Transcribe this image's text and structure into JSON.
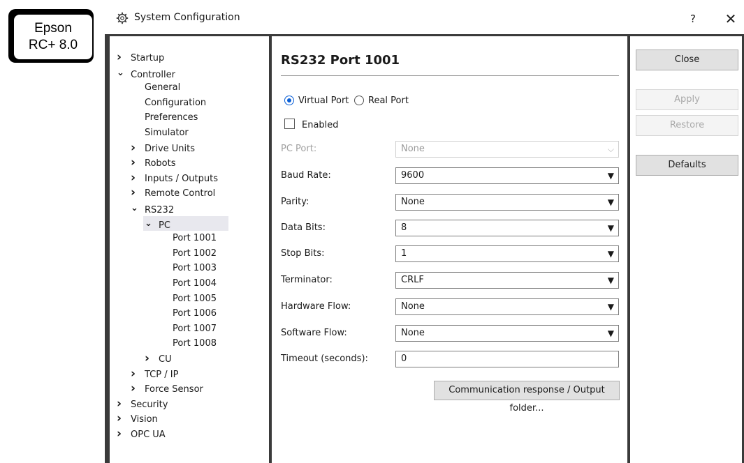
{
  "badge": {
    "line1": "Epson",
    "line2": "RC+ 8.0"
  },
  "window": {
    "title": "System Configuration",
    "help": "?",
    "close": "✕"
  },
  "tree": [
    {
      "label": "Startup",
      "chev": "›",
      "indent": 0
    },
    {
      "label": "Controller",
      "chev": "⌄",
      "indent": 0
    },
    {
      "label": "General",
      "chev": "",
      "indent": 1
    },
    {
      "label": "Configuration",
      "chev": "",
      "indent": 1
    },
    {
      "label": "Preferences",
      "chev": "",
      "indent": 1
    },
    {
      "label": "Simulator",
      "chev": "",
      "indent": 1
    },
    {
      "label": "Drive Units",
      "chev": "›",
      "indent": 1
    },
    {
      "label": "Robots",
      "chev": "›",
      "indent": 1
    },
    {
      "label": "Inputs / Outputs",
      "chev": "›",
      "indent": 1
    },
    {
      "label": "Remote Control",
      "chev": "›",
      "indent": 1
    },
    {
      "label": "RS232",
      "chev": "⌄",
      "indent": 1
    },
    {
      "label": "PC",
      "chev": "⌄",
      "indent": 2
    },
    {
      "label": "Port 1001",
      "chev": "",
      "indent": 3
    },
    {
      "label": "Port 1002",
      "chev": "",
      "indent": 3
    },
    {
      "label": "Port 1003",
      "chev": "",
      "indent": 3
    },
    {
      "label": "Port 1004",
      "chev": "",
      "indent": 3
    },
    {
      "label": "Port 1005",
      "chev": "",
      "indent": 3
    },
    {
      "label": "Port 1006",
      "chev": "",
      "indent": 3
    },
    {
      "label": "Port 1007",
      "chev": "",
      "indent": 3
    },
    {
      "label": "Port 1008",
      "chev": "",
      "indent": 3
    },
    {
      "label": "CU",
      "chev": "›",
      "indent": 2
    },
    {
      "label": "TCP / IP",
      "chev": "›",
      "indent": 1
    },
    {
      "label": "Force Sensor",
      "chev": "›",
      "indent": 1
    },
    {
      "label": "Security",
      "chev": "›",
      "indent": 0
    },
    {
      "label": "Vision",
      "chev": "›",
      "indent": 0
    },
    {
      "label": "OPC UA",
      "chev": "›",
      "indent": 0
    }
  ],
  "panel": {
    "title": "RS232 Port 1001",
    "virtual_port": "Virtual Port",
    "real_port": "Real Port",
    "enabled": "Enabled",
    "pc_port_label": "PC Port:",
    "pc_port_value": "None",
    "baud_label": "Baud Rate:",
    "baud_value": "9600",
    "parity_label": "Parity:",
    "parity_value": "None",
    "databits_label": "Data Bits:",
    "databits_value": "8",
    "stopbits_label": "Stop Bits:",
    "stopbits_value": "1",
    "terminator_label": "Terminator:",
    "terminator_value": "CRLF",
    "hwflow_label": "Hardware Flow:",
    "hwflow_value": "None",
    "swflow_label": "Software Flow:",
    "swflow_value": "None",
    "timeout_label": "Timeout (seconds):",
    "timeout_value": "0",
    "comm_button": "Communication response / Output folder..."
  },
  "buttons": {
    "close": "Close",
    "apply": "Apply",
    "restore": "Restore",
    "defaults": "Defaults"
  },
  "selected_tree_item": "PC"
}
